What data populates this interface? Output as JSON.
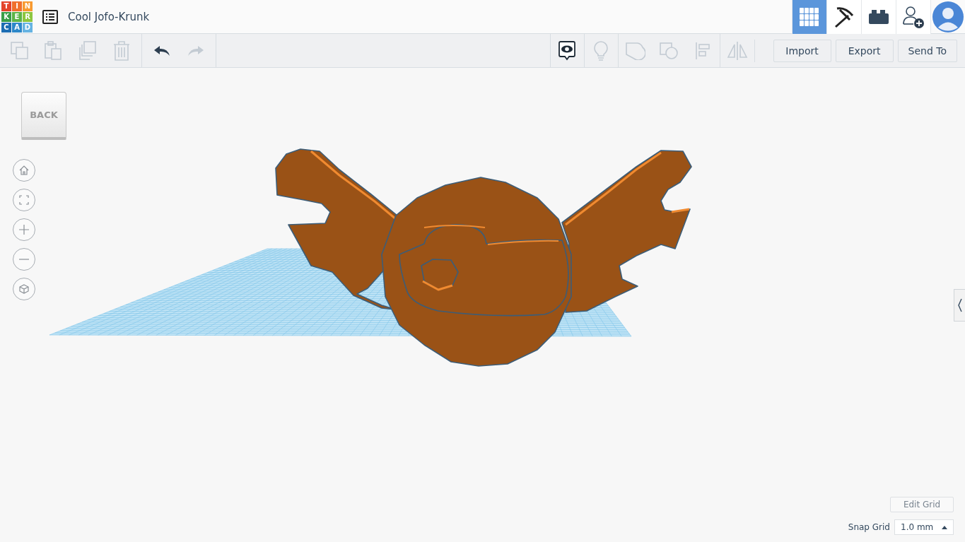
{
  "header": {
    "logo": [
      {
        "letter": "T",
        "color": "#e4432a"
      },
      {
        "letter": "I",
        "color": "#f0702c"
      },
      {
        "letter": "N",
        "color": "#f89a30"
      },
      {
        "letter": "K",
        "color": "#3a9e48"
      },
      {
        "letter": "E",
        "color": "#5cb446"
      },
      {
        "letter": "R",
        "color": "#8dc63f"
      },
      {
        "letter": "C",
        "color": "#1d6db3"
      },
      {
        "letter": "A",
        "color": "#2e88c9"
      },
      {
        "letter": "D",
        "color": "#66b3e2"
      }
    ],
    "title": "Cool Jofo-Krunk",
    "views": [
      {
        "kind": "grid",
        "selected": true
      },
      {
        "kind": "pickaxe",
        "selected": false
      },
      {
        "kind": "brick",
        "selected": false
      }
    ]
  },
  "toolbar": {
    "edit_tools": [
      {
        "kind": "copy",
        "disabled": true
      },
      {
        "kind": "paste",
        "disabled": true
      },
      {
        "kind": "duplicate",
        "disabled": true
      },
      {
        "kind": "delete",
        "disabled": true
      }
    ],
    "history": [
      {
        "kind": "undo",
        "disabled": false
      },
      {
        "kind": "redo",
        "disabled": true
      }
    ],
    "shape_tools": [
      {
        "kind": "notes",
        "disabled": false
      },
      {
        "kind": "bulb",
        "disabled": true
      },
      {
        "kind": "group",
        "disabled": true
      },
      {
        "kind": "ungroup",
        "disabled": true
      },
      {
        "kind": "align",
        "disabled": true
      },
      {
        "kind": "mirror",
        "disabled": true
      }
    ],
    "buttons": [
      "Import",
      "Export",
      "Send To"
    ]
  },
  "view_cube": {
    "face": "BACK"
  },
  "nav_controls": [
    {
      "kind": "home"
    },
    {
      "kind": "fit"
    },
    {
      "kind": "zoom-in"
    },
    {
      "kind": "zoom-out"
    },
    {
      "kind": "ortho"
    }
  ],
  "grid_controls": {
    "edit_button": "Edit Grid",
    "snap_label": "Snap Grid",
    "snap_value": "1.0 mm"
  }
}
